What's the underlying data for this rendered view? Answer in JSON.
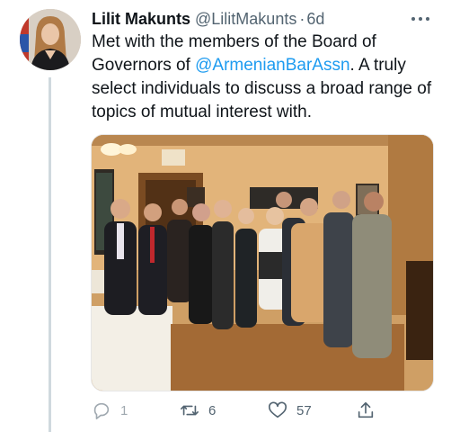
{
  "tweet": {
    "display_name": "Lilit Makunts",
    "handle": "@LilitMakunts",
    "separator": "·",
    "time": "6d",
    "text_before": "Met with the members of the Board of Governors of ",
    "mention": "@ArmenianBarAssn",
    "text_after": ". A truly select individuals to discuss a broad range of topics of mutual interest with."
  },
  "actions": {
    "reply_count": "1",
    "retweet_count": "6",
    "like_count": "57"
  },
  "icons": {
    "more": "more-horizontal-icon",
    "reply": "reply-icon",
    "retweet": "retweet-icon",
    "like": "heart-icon",
    "share": "share-icon"
  },
  "colors": {
    "link": "#1d9bf0",
    "muted": "#536471",
    "text": "#0f1419",
    "thread_line": "#cfd9de"
  }
}
